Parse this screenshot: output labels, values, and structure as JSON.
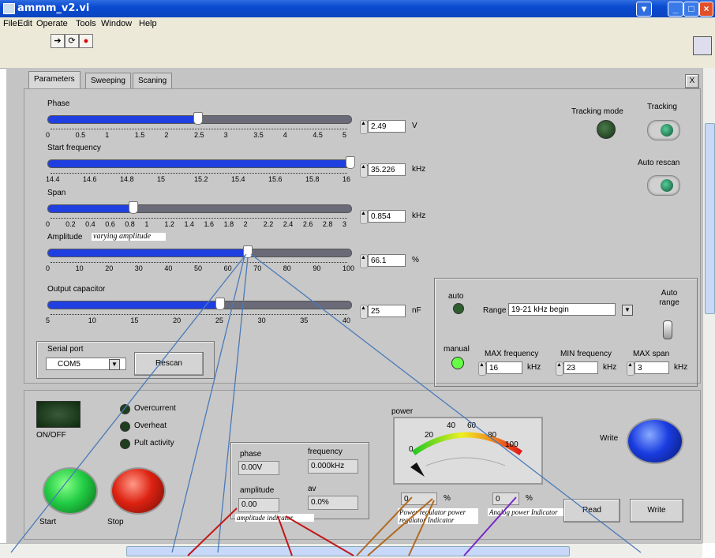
{
  "window": {
    "title": "ammm_v2.vi"
  },
  "menu": [
    "File",
    "Edit",
    "Operate",
    "Tools",
    "Window",
    "Help"
  ],
  "tabs": [
    "Parameters",
    "Sweeping",
    "Scaning"
  ],
  "close_x": "X",
  "sliders": [
    {
      "label": "Phase",
      "value": "2.49",
      "unit": "V",
      "ticks": [
        "0",
        "0.5",
        "1",
        "1.5",
        "2",
        "2.5",
        "3",
        "3.5",
        "4",
        "4.5",
        "5"
      ],
      "fraction": 0.498
    },
    {
      "label": "Start frequency",
      "value": "35.226",
      "unit": "kHz",
      "ticks": [
        "14.4",
        "14.6",
        "14.8",
        "15",
        "15.2",
        "15.4",
        "15.6",
        "15.8",
        "16"
      ],
      "fraction": 1.0
    },
    {
      "label": "Span",
      "value": "0.854",
      "unit": "kHz",
      "ticks": [
        "0",
        "0.2",
        "0.4",
        "0.6",
        "0.8",
        "1",
        "1.2",
        "1.4",
        "1.6",
        "1.8",
        "2",
        "2.2",
        "2.4",
        "2.6",
        "2.8",
        "3"
      ],
      "fraction": 0.285
    },
    {
      "label": "Amplitude",
      "value": "66.1",
      "unit": "%",
      "ticks": [
        "0",
        "10",
        "20",
        "30",
        "40",
        "50",
        "60",
        "70",
        "80",
        "90",
        "100"
      ],
      "fraction": 0.661,
      "note": "varying amplitude"
    },
    {
      "label": "Output capacitor",
      "value": "25",
      "unit": "nF",
      "ticks": [
        "5",
        "10",
        "15",
        "20",
        "25",
        "30",
        "35",
        "40"
      ],
      "fraction": 0.571
    }
  ],
  "serial": {
    "label": "Serial port",
    "value": "COM5",
    "rescan": "Rescan"
  },
  "tracking": {
    "mode_label": "Tracking mode",
    "tracking_label": "Tracking",
    "auto_rescan": "Auto rescan"
  },
  "range_box": {
    "auto": "auto",
    "range_label": "Range",
    "range_value": "19-21 kHz begin",
    "auto_range": "Auto range",
    "manual": "manual",
    "max_freq_label": "MAX frequency",
    "max_freq": "16",
    "min_freq_label": "MIN frequency",
    "min_freq": "23",
    "max_span_label": "MAX span",
    "max_span": "3",
    "unit": "kHz"
  },
  "status": {
    "onoff": "ON/OFF",
    "overcurrent": "Overcurrent",
    "overheat": "Overheat",
    "pult": "Pult activity",
    "start": "Start",
    "stop": "Stop"
  },
  "indicator": {
    "phase_label": "phase",
    "phase": "0.00V",
    "freq_label": "frequency",
    "freq": "0.000kHz",
    "amp_label": "amplitude",
    "amp": "0.00",
    "av_label": "av",
    "av": "0.0%",
    "note": "amplitude indicator"
  },
  "power": {
    "label": "power",
    "gauge_ticks": [
      "0",
      "20",
      "40",
      "60",
      "80",
      "100"
    ],
    "reg_value": "0",
    "reg_unit": "%",
    "reg_note": "Power regulator power regulator Indicator",
    "analog_value": "0",
    "analog_unit": "%",
    "analog_note": "Analog power Indicator",
    "level": 0
  },
  "buttons": {
    "write_label": "Write",
    "read": "Read",
    "write": "Write"
  },
  "colors": {
    "slider_fill": "#1f3fe0",
    "led_green": "#2e5e2e",
    "led_bright": "#66ff44",
    "start": "#22cc44",
    "stop": "#dd2211",
    "write": "#1a3ce0",
    "arrow_blue": "#4a7ab8",
    "arrow_red": "#c01818",
    "arrow_brown": "#b06a20",
    "arrow_purple": "#7a28c8"
  }
}
